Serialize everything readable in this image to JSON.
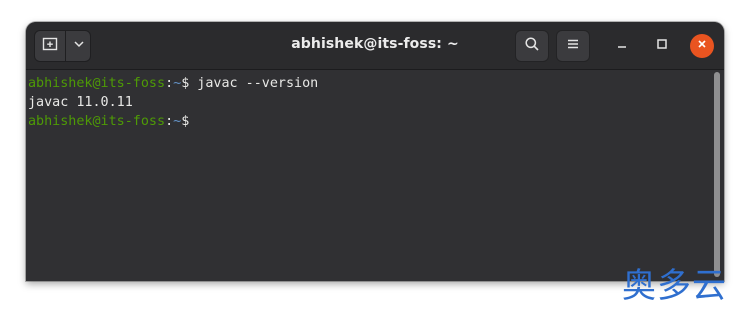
{
  "window": {
    "title": "abhishek@its-foss: ~"
  },
  "toolbar": {
    "new_tab_icon": "new-tab-icon",
    "menu_down_icon": "chevron-down-icon",
    "search_icon": "search-icon",
    "menu_icon": "hamburger-menu-icon",
    "minimize_icon": "minimize-icon",
    "maximize_icon": "maximize-icon",
    "close_icon": "close-icon"
  },
  "colors": {
    "close_button": "#e95420",
    "prompt_user": "#4e9a06",
    "prompt_path": "#6493c8",
    "terminal_bg": "#303033"
  },
  "terminal": {
    "lines": [
      {
        "user": "abhishek@its-foss",
        "colon": ":",
        "path": "~",
        "symbol": "$",
        "command": " javac --version"
      },
      {
        "output": "javac 11.0.11"
      },
      {
        "user": "abhishek@its-foss",
        "colon": ":",
        "path": "~",
        "symbol": "$",
        "command": " "
      }
    ]
  },
  "watermark": {
    "text": "奥多云"
  }
}
